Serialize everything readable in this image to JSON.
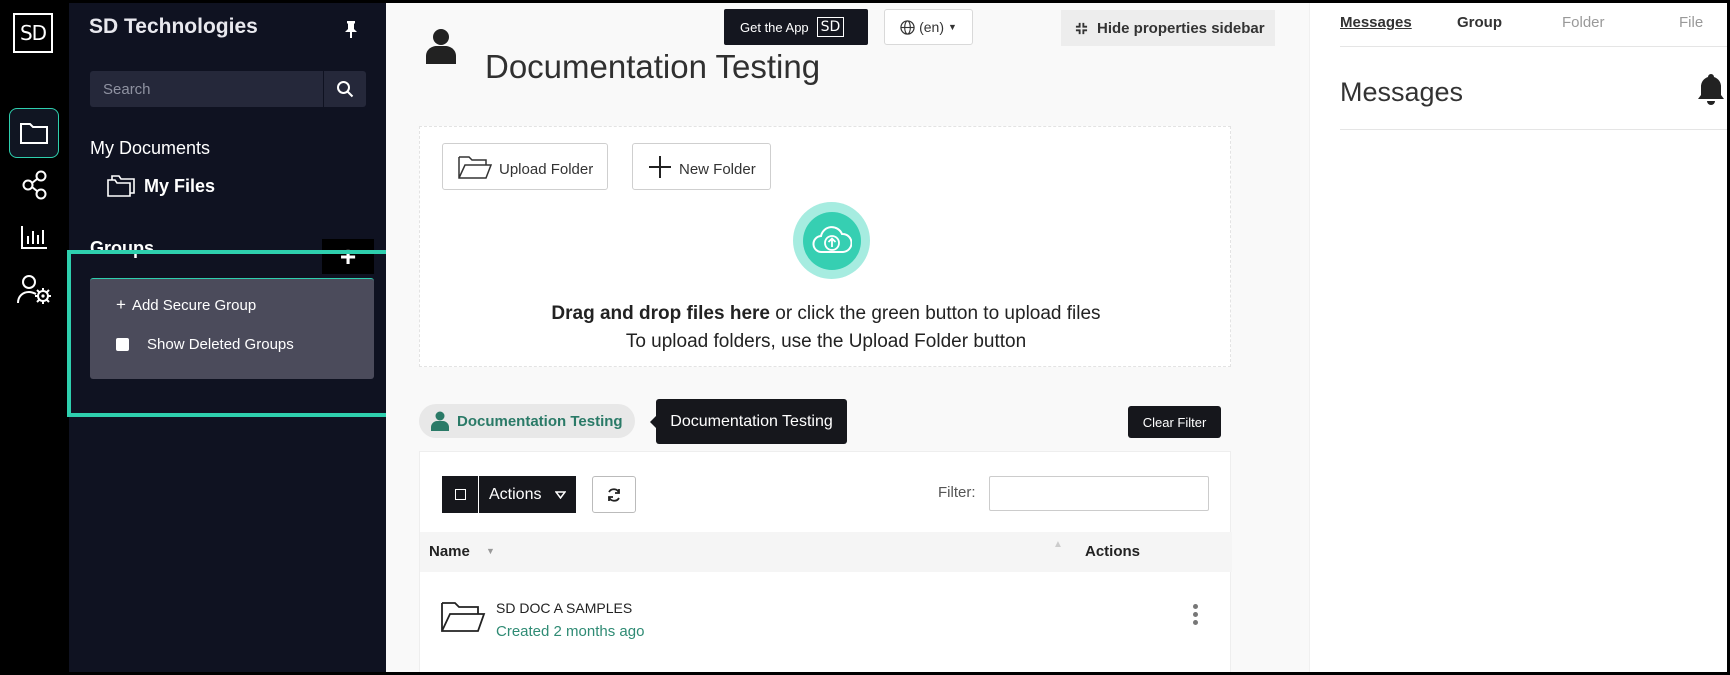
{
  "rail": {
    "logo": "SD",
    "items": [
      {
        "icon": "folder-icon",
        "active": true
      },
      {
        "icon": "share-icon",
        "active": false
      },
      {
        "icon": "chart-icon",
        "active": false
      },
      {
        "icon": "user-settings-icon",
        "active": false
      }
    ]
  },
  "sidebar": {
    "brand": "SD Technologies",
    "search_placeholder": "Search",
    "my_documents": "My Documents",
    "my_files": "My Files",
    "groups": "Groups",
    "dropdown": {
      "add_secure_group": "Add Secure Group",
      "show_deleted_groups": "Show Deleted Groups"
    }
  },
  "header": {
    "title": "Documentation Testing",
    "get_app": "Get the App",
    "get_app_badge": "SD",
    "language": "(en)",
    "hide_sidebar": "Hide properties sidebar"
  },
  "upload": {
    "upload_folder": "Upload Folder",
    "new_folder": "New Folder",
    "drag_bold": "Drag and drop files here",
    "drag_rest": " or click the green button to upload files",
    "folder_hint": "To upload folders, use the Upload Folder button"
  },
  "breadcrumb": {
    "chip": "Documentation Testing",
    "tooltip": "Documentation Testing",
    "clear_filter": "Clear Filter"
  },
  "table": {
    "actions_label": "Actions",
    "filter_label": "Filter:",
    "filter_value": "",
    "col_name": "Name",
    "col_actions": "Actions",
    "rows": [
      {
        "name": "SD DOC A SAMPLES",
        "meta": "Created 2 months ago"
      }
    ]
  },
  "props": {
    "tabs": [
      "Messages",
      "Group",
      "Folder",
      "File"
    ],
    "active_tab": "Messages",
    "title": "Messages"
  },
  "colors": {
    "accent": "#2ecfae",
    "sidebar_bg": "#0f1221",
    "rail_bg": "#000000",
    "link_green": "#2f8b74"
  }
}
